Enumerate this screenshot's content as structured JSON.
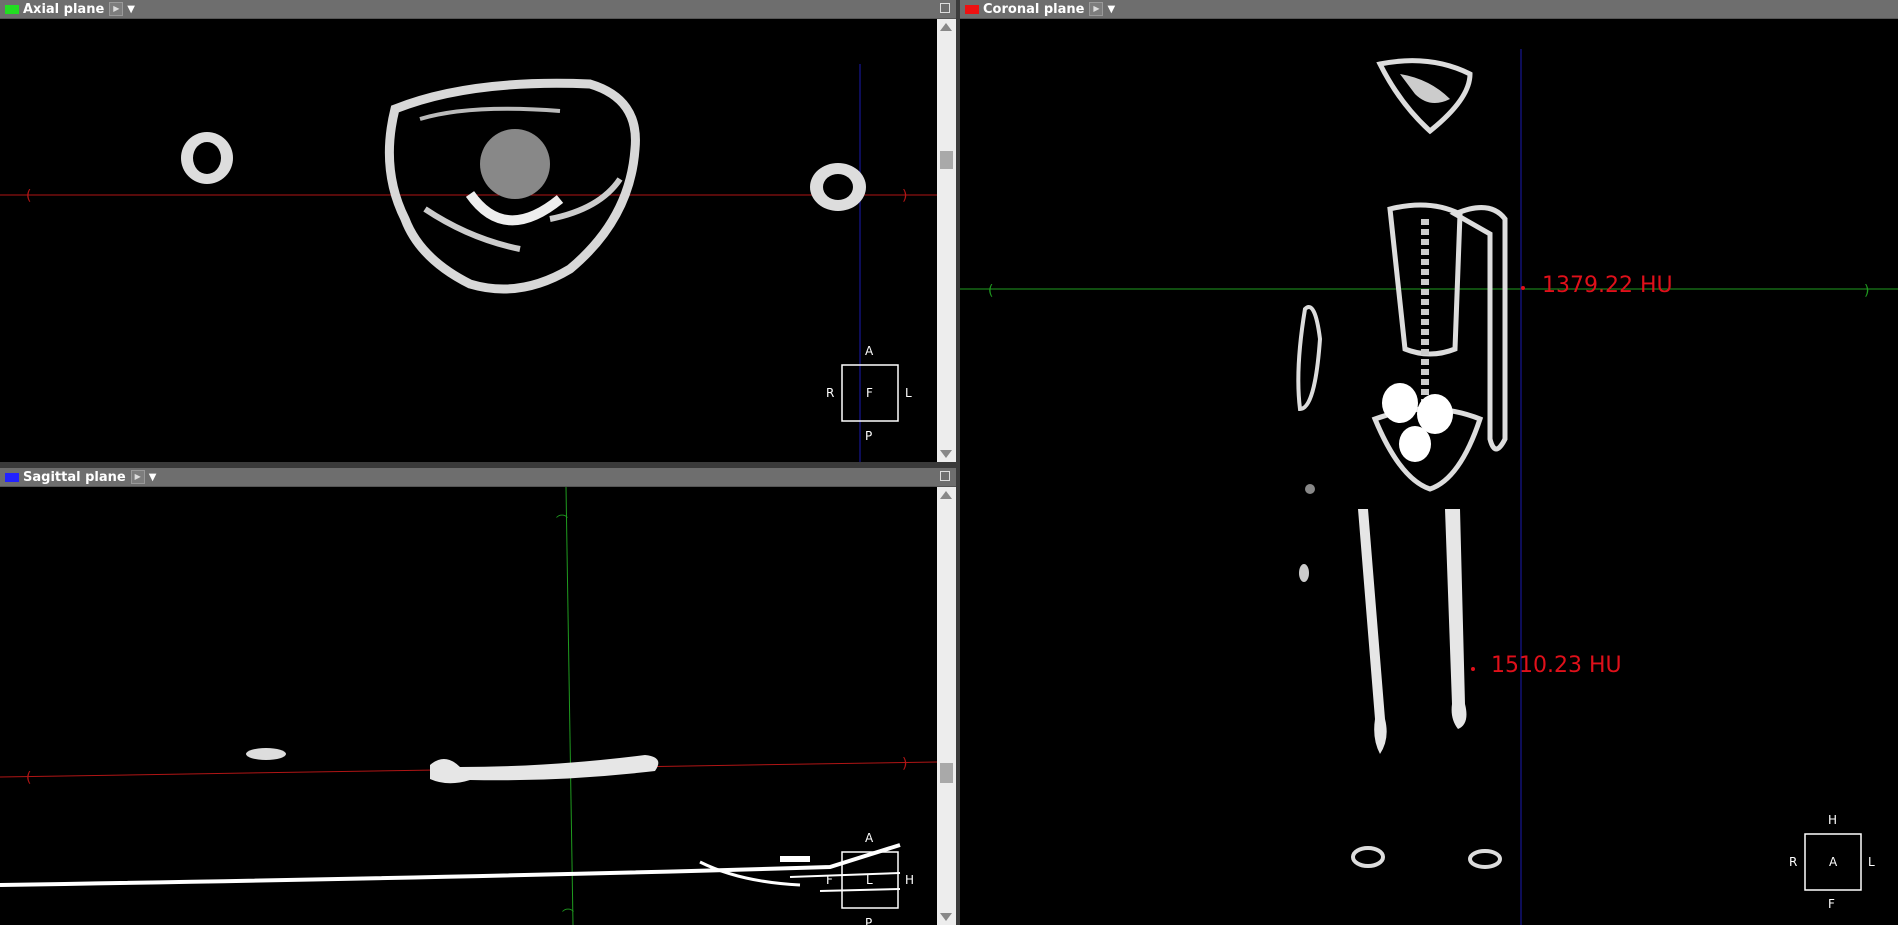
{
  "panels": {
    "axial": {
      "title": "Axial plane",
      "color": "#22dd22"
    },
    "sagittal": {
      "title": "Sagittal plane",
      "color": "#2222ff"
    },
    "coronal": {
      "title": "Coronal plane",
      "color": "#ee1111"
    }
  },
  "orientation": {
    "axial": {
      "top": "A",
      "bottom": "P",
      "left": "R",
      "right": "L",
      "center": "F"
    },
    "sagittal": {
      "top": "A",
      "bottom": "P",
      "left": "F",
      "right": "H",
      "center": "L"
    },
    "coronal": {
      "top": "H",
      "bottom": "F",
      "left": "R",
      "right": "L",
      "center": "A"
    }
  },
  "measurements": [
    {
      "label": "1379.22 HU",
      "color": "#e0101a"
    },
    {
      "label": "1510.23 HU",
      "color": "#e0101a"
    }
  ],
  "crosshair_colors": {
    "axial": "#1f9b1f",
    "sagittal": "#1a1ab0",
    "coronal": "#b01515"
  },
  "icons": {
    "play": "play-icon",
    "dropdown": "chevron-down-icon",
    "maximize": "maximize-icon"
  }
}
